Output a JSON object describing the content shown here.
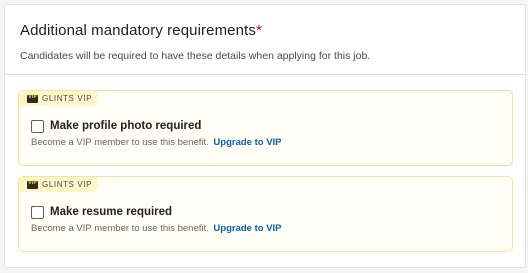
{
  "header": {
    "title": "Additional mandatory requirements",
    "required_mark": "*",
    "subtitle": "Candidates will be required to have these details when applying for this job."
  },
  "options": [
    {
      "tag_badge": "VIP",
      "tag_text": "GLINTS VIP",
      "label": "Make profile photo required",
      "checked": false,
      "note": "Become a VIP member to use this benefit.",
      "link": "Upgrade to VIP"
    },
    {
      "tag_badge": "VIP",
      "tag_text": "GLINTS VIP",
      "label": "Make resume required",
      "checked": false,
      "note": "Become a VIP member to use this benefit.",
      "link": "Upgrade to VIP"
    }
  ],
  "colors": {
    "required_mark": "#e0001b",
    "link": "#0b5fa8",
    "vip_border": "#f5e49a",
    "vip_tag_bg": "#fff6c9"
  }
}
